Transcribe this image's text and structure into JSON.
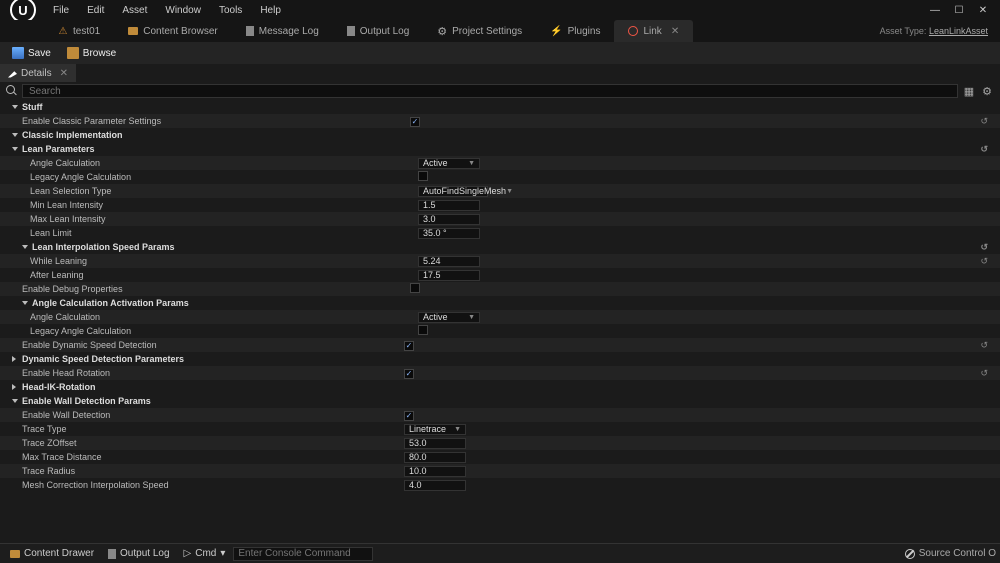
{
  "menu": {
    "items": [
      "File",
      "Edit",
      "Asset",
      "Window",
      "Tools",
      "Help"
    ]
  },
  "tabs": [
    {
      "label": "test01",
      "icon": "warn"
    },
    {
      "label": "Content Browser",
      "icon": "folder"
    },
    {
      "label": "Message Log",
      "icon": "doc"
    },
    {
      "label": "Output Log",
      "icon": "doc"
    },
    {
      "label": "Project Settings",
      "icon": "gear"
    },
    {
      "label": "Plugins",
      "icon": "plug"
    },
    {
      "label": "Link",
      "icon": "link",
      "active": true
    }
  ],
  "asset_type": {
    "prefix": "Asset Type:",
    "name": "LeanLinkAsset"
  },
  "toolbar": {
    "save": "Save",
    "browse": "Browse"
  },
  "panel": {
    "details": "Details",
    "search_placeholder": "Search"
  },
  "categories": {
    "stuff": "Stuff",
    "classic_impl": "Classic Implementation",
    "lean_params": "Lean Parameters",
    "lean_interp": "Lean Interpolation Speed Params",
    "angle_calc_act": "Angle Calculation Activation Params",
    "dyn_speed": "Dynamic Speed Detection Parameters",
    "head_ik": "Head-IK-Rotation",
    "wall_detect": "Enable Wall Detection Params"
  },
  "props": {
    "enable_classic": "Enable Classic Parameter Settings",
    "angle_calc": "Angle Calculation",
    "legacy_angle": "Legacy Angle Calculation",
    "lean_sel_type": "Lean Selection Type",
    "min_lean": "Min Lean Intensity",
    "max_lean": "Max Lean Intensity",
    "lean_limit": "Lean Limit",
    "while_leaning": "While Leaning",
    "after_leaning": "After Leaning",
    "enable_debug": "Enable Debug Properties",
    "angle_calc2": "Angle Calculation",
    "legacy_angle2": "Legacy Angle Calculation",
    "enable_dyn_speed": "Enable Dynamic Speed Detection",
    "enable_head_rot": "Enable Head Rotation",
    "enable_wall_det": "Enable Wall Detection",
    "trace_type": "Trace Type",
    "trace_zoffset": "Trace ZOffset",
    "max_trace_dist": "Max Trace Distance",
    "trace_radius": "Trace Radius",
    "mesh_corr_interp": "Mesh Correction Interpolation Speed"
  },
  "values": {
    "angle_calc": "Active",
    "lean_sel_type": "AutoFindSingleMesh",
    "min_lean": "1.5",
    "max_lean": "3.0",
    "lean_limit": "35.0 °",
    "while_leaning": "5.24",
    "after_leaning": "17.5",
    "angle_calc2": "Active",
    "trace_type": "Linetrace",
    "trace_zoffset": "53.0",
    "max_trace_dist": "80.0",
    "trace_radius": "10.0",
    "mesh_corr_interp": "4.0"
  },
  "bottom": {
    "content_drawer": "Content Drawer",
    "output_log": "Output Log",
    "cmd": "Cmd",
    "console_placeholder": "Enter Console Command",
    "source_control": "Source Control O"
  }
}
